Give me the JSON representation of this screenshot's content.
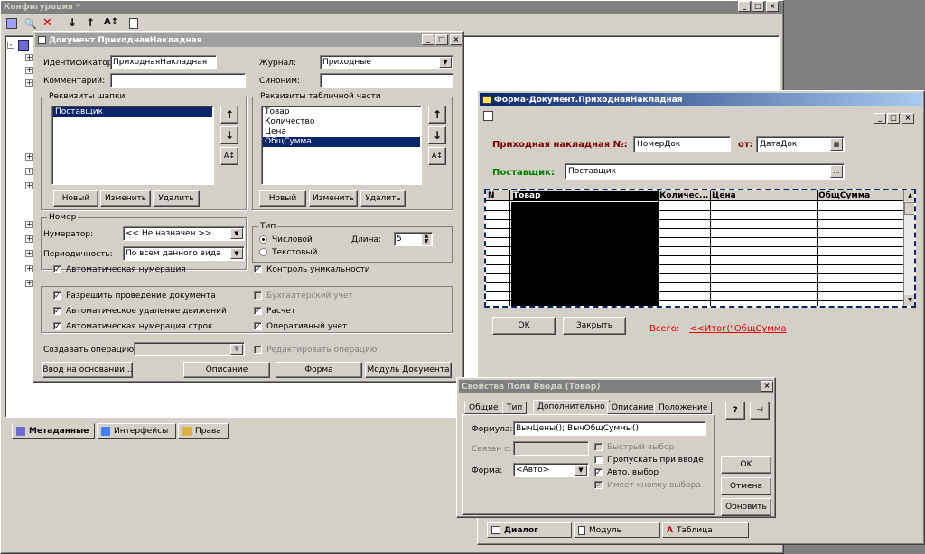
{
  "app": {
    "title": "Конфигурация *",
    "toolbar_icons": [
      "config-icon",
      "find-icon",
      "delete-icon",
      "move-down-icon",
      "move-up-icon",
      "sort-icon",
      "properties-icon"
    ]
  },
  "doc": {
    "title": "Документ ПриходнаяНакладная",
    "id_label": "Идентификатор:",
    "id_value": "ПриходнаяНакладная",
    "comment_label": "Комментарий:",
    "comment_value": "",
    "journal_label": "Журнал:",
    "journal_value": "Приходные",
    "synonym_label": "Синоним:",
    "synonym_value": "",
    "header_group": "Реквизиты шапки",
    "header_items": [
      "Поставщик"
    ],
    "table_group": "Реквизиты табличной части",
    "table_items": [
      "Товар",
      "Количество",
      "Цена",
      "ОбщСумма"
    ],
    "btn_new": "Новый",
    "btn_edit": "Изменить",
    "btn_delete": "Удалить",
    "number_group": "Номер",
    "numerator_label": "Нумератор:",
    "numerator_value": "<< Не назначен >>",
    "period_label": "Периодичность:",
    "period_value": "По всем данного вида",
    "auto_num": "Автоматическая нумерация",
    "type_group": "Тип",
    "type_numeric": "Числовой",
    "type_text": "Текстовый",
    "length_label": "Длина:",
    "length_value": "5",
    "uniqueness": "Контроль уникальности",
    "allow_post": "Разрешить проведение документа",
    "accounting": "Бухгалтерский учет",
    "auto_delete": "Автоматическое удаление движений",
    "calc": "Расчет",
    "auto_rows": "Автоматическая нумерация строк",
    "operative": "Оперативный учет",
    "create_op_label": "Создавать операцию:",
    "edit_op": "Редактировать операцию",
    "btn_basis": "Ввод на основании...",
    "btn_desc": "Описание",
    "btn_form": "Форма",
    "btn_module": "Модуль Документа"
  },
  "meta_tabs": [
    "Метаданные",
    "Интерфейсы",
    "Права"
  ],
  "form": {
    "title": "Форма-Документ.ПриходнаяНакладная",
    "heading": "Приходная накладная №:",
    "number_value": "НомерДок",
    "from_label": "от:",
    "date_value": "ДатаДок",
    "supplier_label": "Поставщик:",
    "supplier_value": "Поставщик",
    "columns": [
      "N",
      "Товар",
      "Количес...",
      "Цена",
      "ОбщСумма"
    ],
    "btn_ok": "OK",
    "btn_close": "Закрыть",
    "total_label": "Всего:",
    "total_value": "<<Итог(\"ОбщСумма"
  },
  "props": {
    "title": "Свойства  Поля Ввода (Товар)",
    "tabs": [
      "Общие",
      "Тип",
      "Дополнительно",
      "Описание",
      "Положение"
    ],
    "formula_label": "Формула:",
    "formula_value": "ВычЦены(); ВычОбщСуммы()",
    "linked_label": "Связан с:",
    "form_label": "Форма:",
    "form_value": "<Авто>",
    "quick_select": "Быстрый выбор",
    "skip_input": "Пропускать при вводе",
    "auto_select": "Авто. выбор",
    "has_select_btn": "Имеет кнопку выбора",
    "btn_ok": "OK",
    "btn_cancel": "Отмена",
    "btn_refresh": "Обновить"
  },
  "form_tabs": [
    "Диалог",
    "Модуль",
    "Таблица"
  ]
}
